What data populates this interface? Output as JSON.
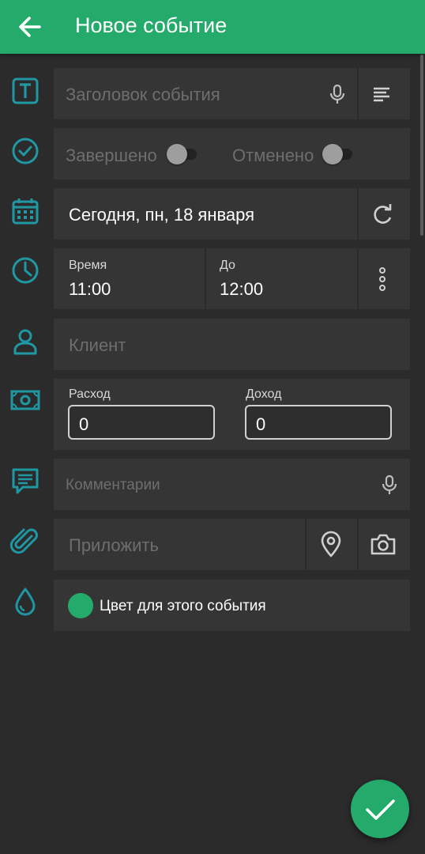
{
  "header": {
    "title": "Новое событие",
    "back_icon": "arrow-left-icon"
  },
  "accent_color": "#24ab6b",
  "icon_color": "#1f98a3",
  "title_field": {
    "placeholder": "Заголовок события",
    "mic_icon": "microphone-icon",
    "format_icon": "text-align-icon"
  },
  "status": {
    "completed_label": "Завершено",
    "completed_on": false,
    "cancelled_label": "Отменено",
    "cancelled_on": false
  },
  "date": {
    "value": "Сегодня, пн, 18 января",
    "repeat_icon": "repeat-icon"
  },
  "time": {
    "from_label": "Время",
    "from_value": "11:00",
    "to_label": "До",
    "to_value": "12:00",
    "more_icon": "more-vertical-icon"
  },
  "client": {
    "placeholder": "Клиент"
  },
  "money": {
    "expense_label": "Расход",
    "expense_value": "0",
    "income_label": "Доход",
    "income_value": "0"
  },
  "comment": {
    "placeholder": "Комментарии"
  },
  "attach": {
    "placeholder": "Приложить",
    "location_icon": "location-pin-icon",
    "camera_icon": "camera-icon"
  },
  "color": {
    "label": "Цвет для этого события",
    "value": "#24ab6b"
  },
  "fab": {
    "icon": "check-icon"
  }
}
